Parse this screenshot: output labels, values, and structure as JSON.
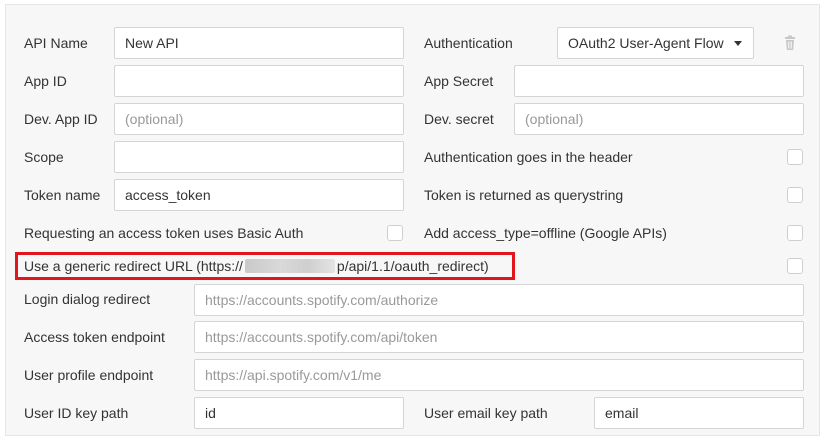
{
  "form": {
    "api_name": {
      "label": "API Name",
      "value": "New API"
    },
    "authentication": {
      "label": "Authentication",
      "selected": "OAuth2 User-Agent Flow"
    },
    "app_id": {
      "label": "App ID",
      "value": ""
    },
    "app_secret": {
      "label": "App Secret",
      "value": ""
    },
    "dev_app_id": {
      "label": "Dev. App ID",
      "placeholder": "(optional)"
    },
    "dev_secret": {
      "label": "Dev. secret",
      "placeholder": "(optional)"
    },
    "scope": {
      "label": "Scope",
      "value": ""
    },
    "auth_header": {
      "label": "Authentication goes in the header",
      "checked": false
    },
    "token_name": {
      "label": "Token name",
      "value": "access_token"
    },
    "token_querystring": {
      "label": "Token is returned as querystring",
      "checked": false
    },
    "basic_auth": {
      "label": "Requesting an access token uses Basic Auth",
      "checked": false
    },
    "access_type_offline": {
      "label": "Add access_type=offline (Google APIs)",
      "checked": false
    },
    "generic_redirect": {
      "label_prefix": "Use a generic redirect URL (https://",
      "label_suffix": "p/api/1.1/oauth_redirect)",
      "checked": false
    },
    "login_dialog_redirect": {
      "label": "Login dialog redirect",
      "placeholder": "https://accounts.spotify.com/authorize"
    },
    "access_token_endpoint": {
      "label": "Access token endpoint",
      "placeholder": "https://accounts.spotify.com/api/token"
    },
    "user_profile_endpoint": {
      "label": "User profile endpoint",
      "placeholder": "https://api.spotify.com/v1/me"
    },
    "user_id_key_path": {
      "label": "User ID key path",
      "value": "id"
    },
    "user_email_key_path": {
      "label": "User email key path",
      "value": "email"
    }
  },
  "icons": {
    "delete": "trash-icon",
    "dropdown": "chevron-down-icon"
  },
  "colors": {
    "highlight": "#e0161c",
    "panel_bg": "#f7f7f7",
    "input_border": "#d5d5d5",
    "placeholder": "#999999"
  }
}
